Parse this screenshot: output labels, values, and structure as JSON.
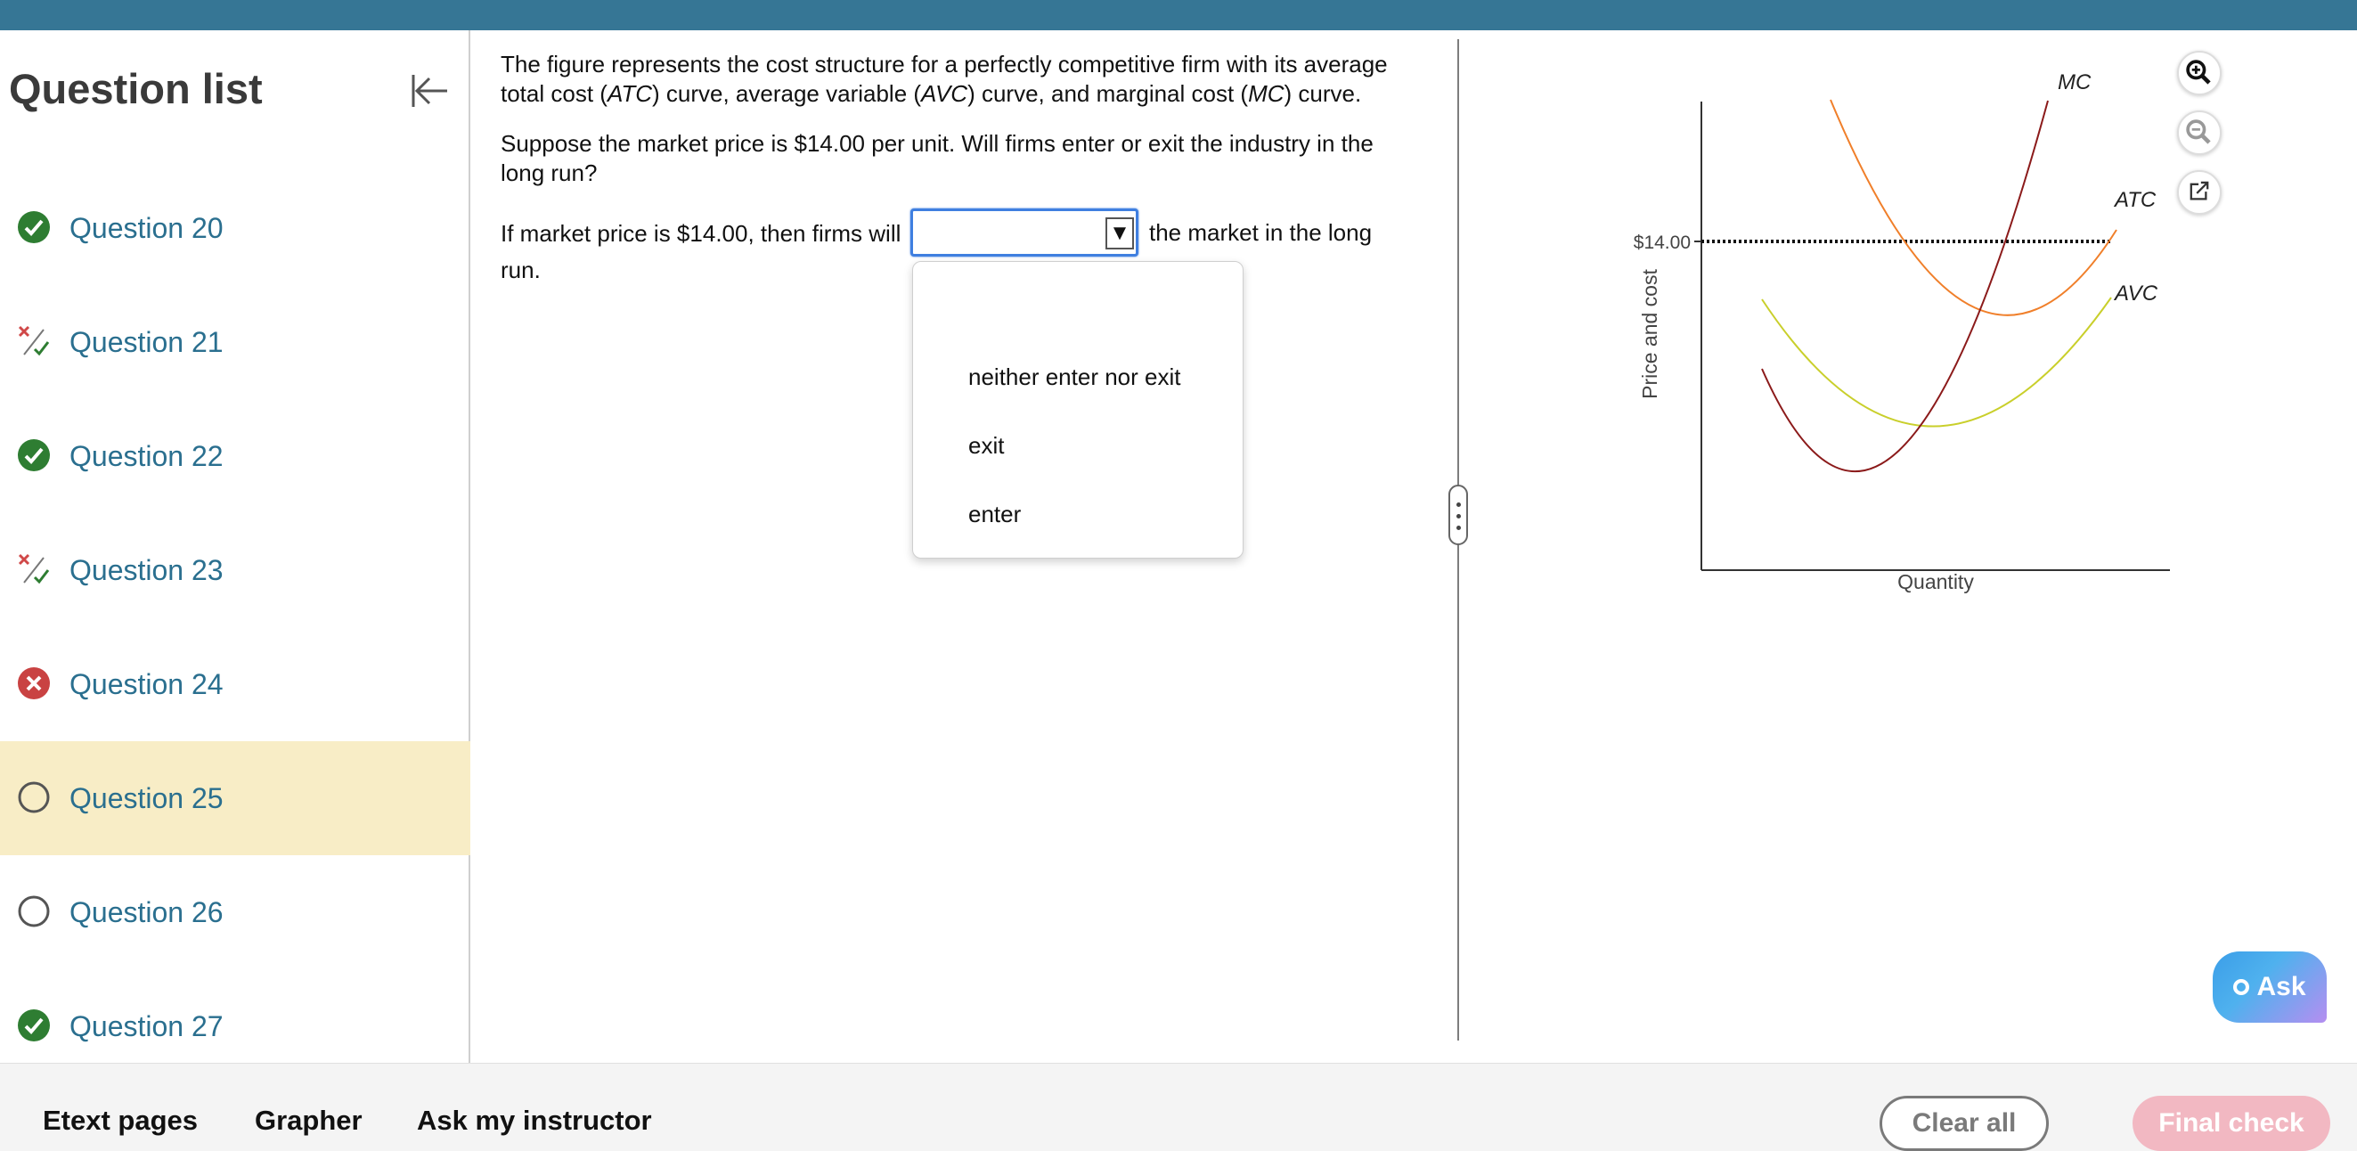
{
  "sidebar": {
    "title": "Question list",
    "items": [
      {
        "label": "Question 20",
        "status": "correct"
      },
      {
        "label": "Question 21",
        "status": "partial"
      },
      {
        "label": "Question 22",
        "status": "correct"
      },
      {
        "label": "Question 23",
        "status": "partial"
      },
      {
        "label": "Question 24",
        "status": "incorrect"
      },
      {
        "label": "Question 25",
        "status": "unanswered",
        "active": true
      },
      {
        "label": "Question 26",
        "status": "unanswered"
      },
      {
        "label": "Question 27",
        "status": "correct"
      }
    ]
  },
  "question": {
    "intro_line1_a": "The figure represents the cost structure for a perfectly competitive firm with its average",
    "intro_line2_a": "total cost (",
    "atc": "ATC",
    "intro_line2_b": ") curve, average variable (",
    "avc": "AVC",
    "intro_line2_c": ") curve, and marginal cost (",
    "mc": "MC",
    "intro_line2_d": ") curve.",
    "prompt_line1": "Suppose the market price is $14.00 per unit. Will firms enter or exit the industry in the",
    "prompt_line2": "long run?",
    "answer_before": "If market price is $14.00, then firms will",
    "answer_after": "the market in the long",
    "answer_run": "run.",
    "dropdown_value": "",
    "options": [
      "neither enter nor exit",
      "exit",
      "enter"
    ]
  },
  "graph": {
    "price_label": "$14.00",
    "ylabel": "Price and cost",
    "xlabel": "Quantity",
    "curve_labels": {
      "mc": "MC",
      "atc": "ATC",
      "avc": "AVC"
    },
    "colors": {
      "mc": "#8b1a1a",
      "atc": "#f07f2a",
      "avc": "#c9cf2b"
    }
  },
  "ask": {
    "label": "Ask"
  },
  "bottom": {
    "etext": "Etext pages",
    "grapher": "Grapher",
    "instructor": "Ask my instructor",
    "clear": "Clear all",
    "final": "Final check"
  }
}
